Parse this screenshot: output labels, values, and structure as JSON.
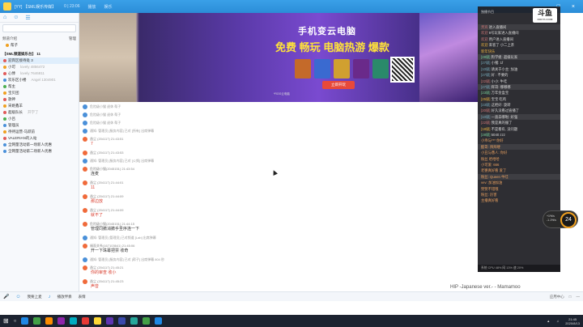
{
  "window": {
    "title": "[YY] 【SML娱乐传媒】",
    "tabs": [
      "0 | 23:06",
      "播放",
      "娱乐"
    ],
    "controls": [
      "—",
      "□",
      "×"
    ]
  },
  "leftpanel": {
    "toolbar_icons": [
      "home-icon",
      "people-icon",
      "list-icon"
    ],
    "sections": [
      {
        "label": "频道介绍",
        "right": "管理"
      },
      {
        "label": "帮子",
        "right": ""
      }
    ],
    "channel_title": "【SML频道娱乐台】 11",
    "rows": [
      {
        "text": "迎宾区接待处 3",
        "note": "",
        "color": "r",
        "selected": true
      },
      {
        "text": "小可",
        "note": "lovely 4856472",
        "color": "o"
      },
      {
        "text": "心悸",
        "note": "lovely 7646811",
        "color": "r"
      },
      {
        "text": "欢乐区小楼",
        "note": "Angel 1304901",
        "color": "b"
      },
      {
        "text": "帮主",
        "note": "",
        "color": "g"
      },
      {
        "text": "宝贝团",
        "note": "",
        "color": "o"
      },
      {
        "text": "歌神",
        "note": "",
        "color": "r"
      },
      {
        "text": "宋姬鑫羊",
        "note": "",
        "color": "o"
      },
      {
        "text": "超级队长",
        "note": "开学了",
        "color": "r"
      },
      {
        "text": "小吕",
        "note": "",
        "color": "g"
      },
      {
        "text": "管理员",
        "note": "",
        "color": "b"
      },
      {
        "text": "待待运营-马跃前",
        "note": "",
        "color": "o"
      },
      {
        "text": "VALERIAN的入站",
        "note": "",
        "color": "r"
      },
      {
        "text": "全网量活动第一场新人优惠",
        "note": "",
        "color": "b"
      },
      {
        "text": "全网量活动第二场新人优惠",
        "note": "",
        "color": "b"
      }
    ]
  },
  "banner": {
    "headline": "手机变云电脑",
    "subline": "免费 畅玩 电脑热游 爆款",
    "button": "立即开玩",
    "fineprint": "*ROG云电脑"
  },
  "chat": {
    "messages": [
      {
        "meta": "危险级小猫 退休 帮子",
        "text": "",
        "style": "sys"
      },
      {
        "meta": "危险级小猫 退休 帮子",
        "text": "",
        "style": "sys"
      },
      {
        "meta": "危险级小猫 退休 帮子",
        "text": "",
        "style": "sys"
      },
      {
        "meta": "通知: 管理员 [服务内容] 已对 [所有] 出席弹幕",
        "text": "",
        "style": "sys"
      },
      {
        "meta": "逸尘 (204117) 21:43:51",
        "text": "7",
        "style": "red"
      },
      {
        "meta": "逸尘 (204117) 21:43:53",
        "text": "",
        "style": "red"
      },
      {
        "meta": "通知: 管理员 [服务内容] 已对 [公频] 出席弹幕",
        "text": "",
        "style": "sys"
      },
      {
        "meta": "危险级小猫(2045151) 21:43:54",
        "text": "连麦",
        "style": "plain"
      },
      {
        "meta": "逸尘 (204117) 21:44:01",
        "text": "11",
        "style": "red"
      },
      {
        "meta": "逸尘 (204117) 21:44:09",
        "text": "那边放",
        "style": "red"
      },
      {
        "meta": "逸尘 (204117) 21:44:09",
        "text": "就不了",
        "style": "red"
      },
      {
        "meta": "危险级小猫(2045151) 21:44:15",
        "text": "管理同撤消撤手圣序连一下",
        "style": "plain"
      },
      {
        "meta": "通知: 管理员 [管理员] 已对频道 [Lab] 出席弹幕",
        "text": "",
        "style": "sys"
      },
      {
        "meta": "福面关系(167103641) 21:45:06",
        "text": "开一下珠幕把票 收奇",
        "style": "plain"
      },
      {
        "meta": "通知: 管理员 [服务内容] 已对 [帮子] 出席弹幕 804 秒",
        "text": "",
        "style": "sys"
      },
      {
        "meta": "逸尘 (204117) 21:45:21",
        "text": "你的审查 收小",
        "style": "red"
      },
      {
        "meta": "逸尘 (204117) 21:45:23",
        "text": "声音",
        "style": "red"
      }
    ]
  },
  "inputbar": {
    "items": [
      "我要上麦",
      "播放伴奏",
      "表情"
    ],
    "right": [
      "应用中心",
      "□",
      "—"
    ]
  },
  "rightpanel": {
    "label": "独播节目",
    "logo": "斗鱼",
    "logo_sub": "DOUYU.COM",
    "lines": [
      {
        "u": "贵宾",
        "t": "进入直播间",
        "c": "u"
      },
      {
        "u": "欢迎",
        "t": "8号玩家进入直播间",
        "c": "u"
      },
      {
        "u": "欢迎",
        "t": "用户进入直播间",
        "c": "u"
      },
      {
        "u": "欢迎",
        "t": "来客了 小二上茶",
        "c": "y"
      },
      {
        "u": "新年快乐",
        "t": "",
        "c": "y"
      },
      {
        "u": "[28级]",
        "t": "狗学姐: 超级玩家",
        "c": "g"
      },
      {
        "u": "[27级]",
        "t": "小猪: 1f",
        "c": "u2"
      },
      {
        "u": "[10级]",
        "t": "请关于小主: 加油",
        "c": "u2"
      },
      {
        "u": "[27级]",
        "t": "好 : 不要的",
        "c": "u2"
      },
      {
        "u": "[22级]",
        "t": "小小: 牛哇",
        "c": "u"
      },
      {
        "u": "[27级]",
        "t": "辉哥: 哪哪哪",
        "c": "u2"
      },
      {
        "u": "[23级]",
        "t": "万年金盒宝",
        "c": "g"
      },
      {
        "u": "[25级]",
        "t": "宝宝 吃鸡",
        "c": "y"
      },
      {
        "u": "[23级]",
        "t": "这把好: 旋转",
        "c": "u2"
      },
      {
        "u": "[20级]",
        "t": "好久没看过直播了",
        "c": "u"
      },
      {
        "u": "[10级]",
        "t": "一直去哪啦: 好强",
        "c": "u2"
      },
      {
        "u": "[22级]",
        "t": "我是真的服了",
        "c": "u"
      },
      {
        "u": "[18级]",
        "t": "不是看有, 没问题",
        "c": "y"
      },
      {
        "u": "[28级]",
        "t": "5040 zzz",
        "c": "g"
      },
      {
        "u": "",
        "t": "小乖与*** 你好",
        "c": "warm"
      },
      {
        "u": "",
        "t": "酷哥: 拜拜喽",
        "c": "warm"
      },
      {
        "u": "",
        "t": "小丑与愚人: 你好",
        "c": "warm"
      },
      {
        "u": "",
        "t": "粉丝 哈哈哈",
        "c": "warm"
      },
      {
        "u": "",
        "t": "小可爱: 666",
        "c": "warm"
      },
      {
        "u": "",
        "t": "老婆真好看 爱了",
        "c": "warm"
      },
      {
        "u": "",
        "t": "粉丝: Queen 牛哇",
        "c": "warm"
      },
      {
        "u": "",
        "t": "vev: 加油加油",
        "c": "warm"
      },
      {
        "u": "",
        "t": "赞赞不错哦",
        "c": "warm"
      },
      {
        "u": "",
        "t": "粉丝: 厉害",
        "c": "warm"
      },
      {
        "u": "",
        "t": "主播真好看",
        "c": "warm"
      }
    ],
    "footer": "系统 CPU 48%  网 13%  速 20%"
  },
  "speed": {
    "value": "24",
    "up": "+1%/s",
    "down": "-1.1%/s"
  },
  "music": "HIP -Japanese ver.- - Mamamoo",
  "taskbar": {
    "time": "21:45",
    "date": "2020/8/13",
    "apps": [
      "#1e88e5",
      "#43a047",
      "#fb8c00",
      "#8e24aa",
      "#00acc1",
      "#e53935",
      "#fdd835",
      "#5e35b1",
      "#3949ab",
      "#26a69a",
      "#43a047",
      "#1e88e5"
    ]
  }
}
